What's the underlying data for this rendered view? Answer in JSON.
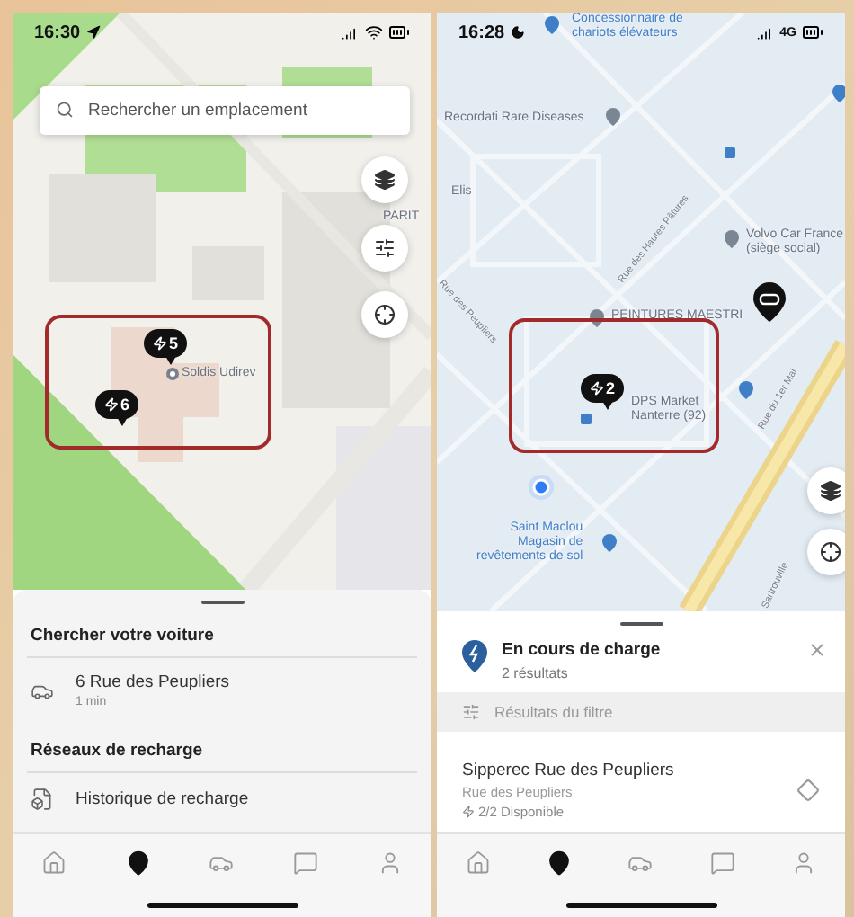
{
  "left_screen": {
    "status_bar": {
      "time": "16:30"
    },
    "search": {
      "placeholder": "Rechercher un emplacement"
    },
    "map_labels": [
      {
        "kind": "place",
        "lines": [
          "PARIT"
        ]
      },
      {
        "kind": "place",
        "lines": [
          "Soldis Udirev"
        ]
      }
    ],
    "charging_markers": [
      {
        "count": "5"
      },
      {
        "count": "6"
      }
    ],
    "sheet": {
      "sections": [
        {
          "title": "Chercher votre voiture",
          "items": [
            {
              "kind": "car",
              "title": "6 Rue des Peupliers",
              "subtitle": "1 min"
            }
          ]
        },
        {
          "title": "Réseaux de recharge",
          "items": [
            {
              "kind": "history",
              "title": "Historique de recharge"
            }
          ]
        }
      ]
    },
    "nav": [
      {
        "selected": false
      },
      {
        "selected": true
      },
      {
        "selected": false
      },
      {
        "selected": false
      },
      {
        "selected": false
      }
    ]
  },
  "right_screen": {
    "status_bar": {
      "time": "16:28",
      "network": "4G"
    },
    "map_labels": [
      {
        "kind": "shop",
        "lines": [
          "Concessionnaire de",
          "chariots élévateurs"
        ]
      },
      {
        "kind": "place",
        "lines": [
          "Recordati Rare Diseases"
        ]
      },
      {
        "kind": "place",
        "lines": [
          "Elis"
        ]
      },
      {
        "kind": "place",
        "lines": [
          "Volvo Car France",
          "(siège social)"
        ]
      },
      {
        "kind": "place",
        "lines": [
          "PEINTURES MAESTRI"
        ]
      },
      {
        "kind": "place",
        "lines": [
          "DPS Market",
          "Nanterre (92)"
        ]
      },
      {
        "kind": "shop",
        "lines": [
          "Saint Maclou",
          "Magasin de",
          "revêtements de sol"
        ]
      },
      {
        "kind": "street",
        "lines": [
          "Rue des Hautes Pâtures"
        ]
      },
      {
        "kind": "street",
        "lines": [
          "Rue des Peupliers"
        ]
      },
      {
        "kind": "street",
        "lines": [
          "Rue du 1er Mai"
        ]
      },
      {
        "kind": "street",
        "lines": [
          "Sartrouville"
        ]
      }
    ],
    "charging_markers": [
      {
        "count": "2"
      }
    ],
    "sheet": {
      "title": "En cours de charge",
      "subtitle": "2 résultats",
      "filter": "Résultats du filtre",
      "station": {
        "name": "Sipperec Rue des Peupliers",
        "address": "Rue des Peupliers",
        "availability": "2/2 Disponible"
      }
    },
    "nav": [
      {
        "selected": false
      },
      {
        "selected": true
      },
      {
        "selected": false
      },
      {
        "selected": false
      },
      {
        "selected": false
      }
    ]
  }
}
